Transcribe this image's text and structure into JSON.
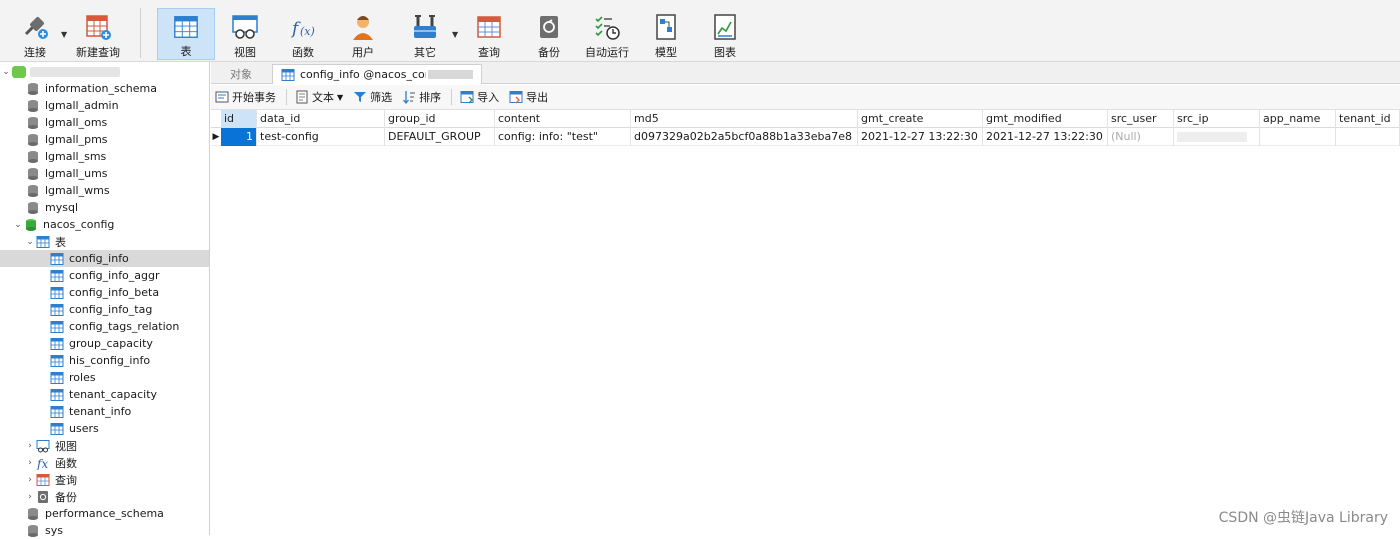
{
  "toolbar": {
    "buttons": [
      {
        "id": "connect",
        "label": "连接"
      },
      {
        "id": "new-query",
        "label": "新建查询"
      },
      {
        "id": "table",
        "label": "表"
      },
      {
        "id": "view",
        "label": "视图"
      },
      {
        "id": "function",
        "label": "函数"
      },
      {
        "id": "user",
        "label": "用户"
      },
      {
        "id": "other",
        "label": "其它"
      },
      {
        "id": "query",
        "label": "查询"
      },
      {
        "id": "backup",
        "label": "备份"
      },
      {
        "id": "auto-run",
        "label": "自动运行"
      },
      {
        "id": "model",
        "label": "模型"
      },
      {
        "id": "chart",
        "label": "图表"
      }
    ],
    "active": "table",
    "accent": "#cde3f7"
  },
  "sidebar": {
    "databases": [
      "information_schema",
      "lgmall_admin",
      "lgmall_oms",
      "lgmall_pms",
      "lgmall_sms",
      "lgmall_ums",
      "lgmall_wms",
      "mysql",
      "nacos_config"
    ],
    "tables_folder": "表",
    "tables": [
      "config_info",
      "config_info_aggr",
      "config_info_beta",
      "config_info_tag",
      "config_tags_relation",
      "group_capacity",
      "his_config_info",
      "roles",
      "tenant_capacity",
      "tenant_info",
      "users"
    ],
    "selected_table": "config_info",
    "folders": [
      "视图",
      "函数",
      "查询",
      "备份"
    ],
    "after_databases": [
      "performance_schema",
      "sys"
    ]
  },
  "tabs": {
    "objects": "对象",
    "active": "config_info @nacos_config"
  },
  "subtoolbar": {
    "begin_tx": "开始事务",
    "text": "文本",
    "filter": "筛选",
    "sort": "排序",
    "import": "导入",
    "export": "导出"
  },
  "grid": {
    "columns": [
      "id",
      "data_id",
      "group_id",
      "content",
      "md5",
      "gmt_create",
      "gmt_modified",
      "src_user",
      "src_ip",
      "app_name",
      "tenant_id"
    ],
    "rows": [
      [
        "1",
        "test-config",
        "DEFAULT_GROUP",
        "config:  info: \"test\"",
        "d097329a02b2a5bcf0a88b1a33eba7e8",
        "2021-12-27 13:22:30",
        "2021-12-27 13:22:30",
        "(Null)",
        "",
        "",
        ""
      ]
    ]
  },
  "watermark": "CSDN @虫链Java Library"
}
